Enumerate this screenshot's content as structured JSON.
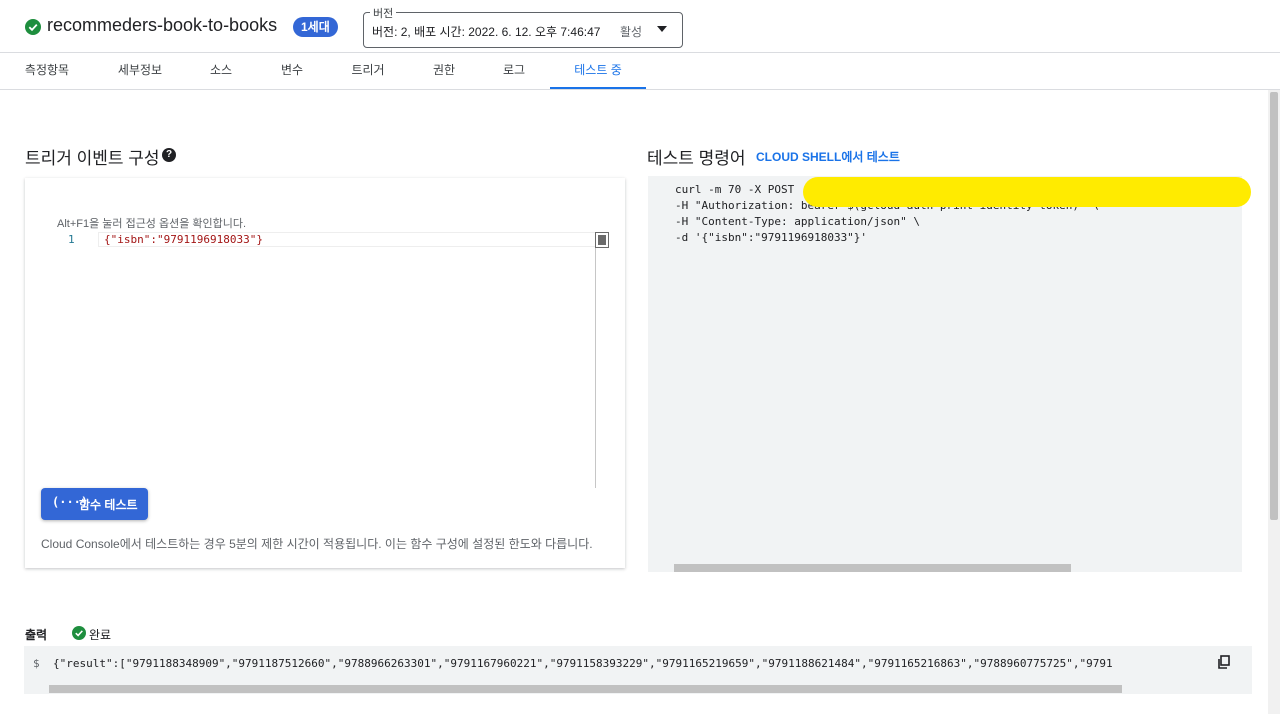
{
  "header": {
    "function_name": "recommeders-book-to-books",
    "generation_badge": "1세대",
    "version_label": "버전",
    "version_value": "버전: 2, 배포 시간: 2022. 6. 12. 오후 7:46:47",
    "version_status": "활성"
  },
  "tabs": [
    {
      "label": "측정항목"
    },
    {
      "label": "세부정보"
    },
    {
      "label": "소스"
    },
    {
      "label": "변수"
    },
    {
      "label": "트리거"
    },
    {
      "label": "권한"
    },
    {
      "label": "로그"
    },
    {
      "label": "테스트 중"
    }
  ],
  "active_tab": "테스트 중",
  "trigger_section": {
    "title": "트리거 이벤트 구성",
    "editor_hint": "Alt+F1을 눌러 접근성 옵션을 확인합니다.",
    "line_number": "1",
    "code": "{\"isbn\":\"9791196918033\"}",
    "test_button_icon": "(···)",
    "test_button_label": "함수 테스트",
    "notice": "Cloud Console에서 테스트하는 경우 5분의 제한 시간이 적용됩니다. 이는 함수 구성에 설정된 한도와 다릅니다."
  },
  "command_section": {
    "title": "테스트 명령어",
    "cloudshell_link": "CLOUD SHELL에서 테스트",
    "lines": [
      "curl -m 70 -X POST",
      "-H \"Authorization: bearer $(gcloud auth print-identity-token)\" \\",
      "-H \"Content-Type: application/json\" \\",
      "-d '{\"isbn\":\"9791196918033\"}'"
    ]
  },
  "output_section": {
    "label": "출력",
    "status": "완료",
    "prompt": "$",
    "result": "{\"result\":[\"9791188348909\",\"9791187512660\",\"9788966263301\",\"9791167960221\",\"9791158393229\",\"9791165219659\",\"9791188621484\",\"9791165216863\",\"9788960775725\",\"9791"
  },
  "colors": {
    "accent": "#1a73e8",
    "button": "#3367d6",
    "success": "#1e8e3e",
    "redaction": "#ffeb00"
  }
}
